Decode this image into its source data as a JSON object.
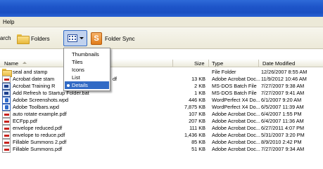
{
  "menubar": {
    "help": "Help"
  },
  "toolbar": {
    "search_label": "arch",
    "folders_label": "Folders",
    "folder_sync_label": "Folder Sync",
    "sync_glyph": "S"
  },
  "views_menu": {
    "items": [
      "Thumbnails",
      "Tiles",
      "Icons",
      "List",
      "Details"
    ],
    "selected": "Details"
  },
  "columns": {
    "name": "Name",
    "size": "Size",
    "type": "Type",
    "date": "Date Modified"
  },
  "files": [
    {
      "name": "seal and stamp",
      "size": "",
      "type": "File Folder",
      "date": "12/26/2007 8:55 AM",
      "icon": "folder-icon"
    },
    {
      "name": "Acrobat date stam",
      "name_tail": "df",
      "size": "13 KB",
      "type": "Adobe Acrobat Doc...",
      "date": "11/9/2012 10:46 AM",
      "icon": "pdf-icon"
    },
    {
      "name": "Acrobat Training R",
      "size": "2 KB",
      "type": "MS-DOS Batch File",
      "date": "7/27/2007 9:38 AM",
      "icon": "batch-file-icon"
    },
    {
      "name": "Add Refresh to Startup Folder.bat",
      "size": "1 KB",
      "type": "MS-DOS Batch File",
      "date": "7/27/2007 9:41 AM",
      "icon": "batch-file-icon"
    },
    {
      "name": "Adobe Screenshots.wpd",
      "size": "446 KB",
      "type": "WordPerfect X4 Do...",
      "date": "6/1/2007 9:20 AM",
      "icon": "wordperfect-icon"
    },
    {
      "name": "Adobe Toolbars.wpd",
      "size": "7,875 KB",
      "type": "WordPerfect X4 Do...",
      "date": "6/5/2007 11:39 AM",
      "icon": "wordperfect-icon"
    },
    {
      "name": "auto rotate example.pdf",
      "size": "107 KB",
      "type": "Adobe Acrobat Doc...",
      "date": "6/4/2007 1:55 PM",
      "icon": "pdf-icon"
    },
    {
      "name": "ECFpp.pdf",
      "size": "207 KB",
      "type": "Adobe Acrobat Doc...",
      "date": "6/4/2007 11:36 AM",
      "icon": "pdf-icon"
    },
    {
      "name": "envelope reduced.pdf",
      "size": "111 KB",
      "type": "Adobe Acrobat Doc...",
      "date": "6/27/2011 4:07 PM",
      "icon": "pdf-icon"
    },
    {
      "name": "envelope to reduce.pdf",
      "size": "1,436 KB",
      "type": "Adobe Acrobat Doc...",
      "date": "5/31/2007 3:20 PM",
      "icon": "pdf-icon"
    },
    {
      "name": "Fillable Summons 2.pdf",
      "size": "85 KB",
      "type": "Adobe Acrobat Doc...",
      "date": "8/9/2010 2:42 PM",
      "icon": "pdf-icon"
    },
    {
      "name": "Fillable Summons.pdf",
      "size": "51 KB",
      "type": "Adobe Acrobat Doc...",
      "date": "7/27/2007 9:34 AM",
      "icon": "pdf-icon"
    }
  ],
  "colors": {
    "titlebar": "#1a4fc2",
    "selection": "#316ac5",
    "chrome": "#ece9d8"
  }
}
